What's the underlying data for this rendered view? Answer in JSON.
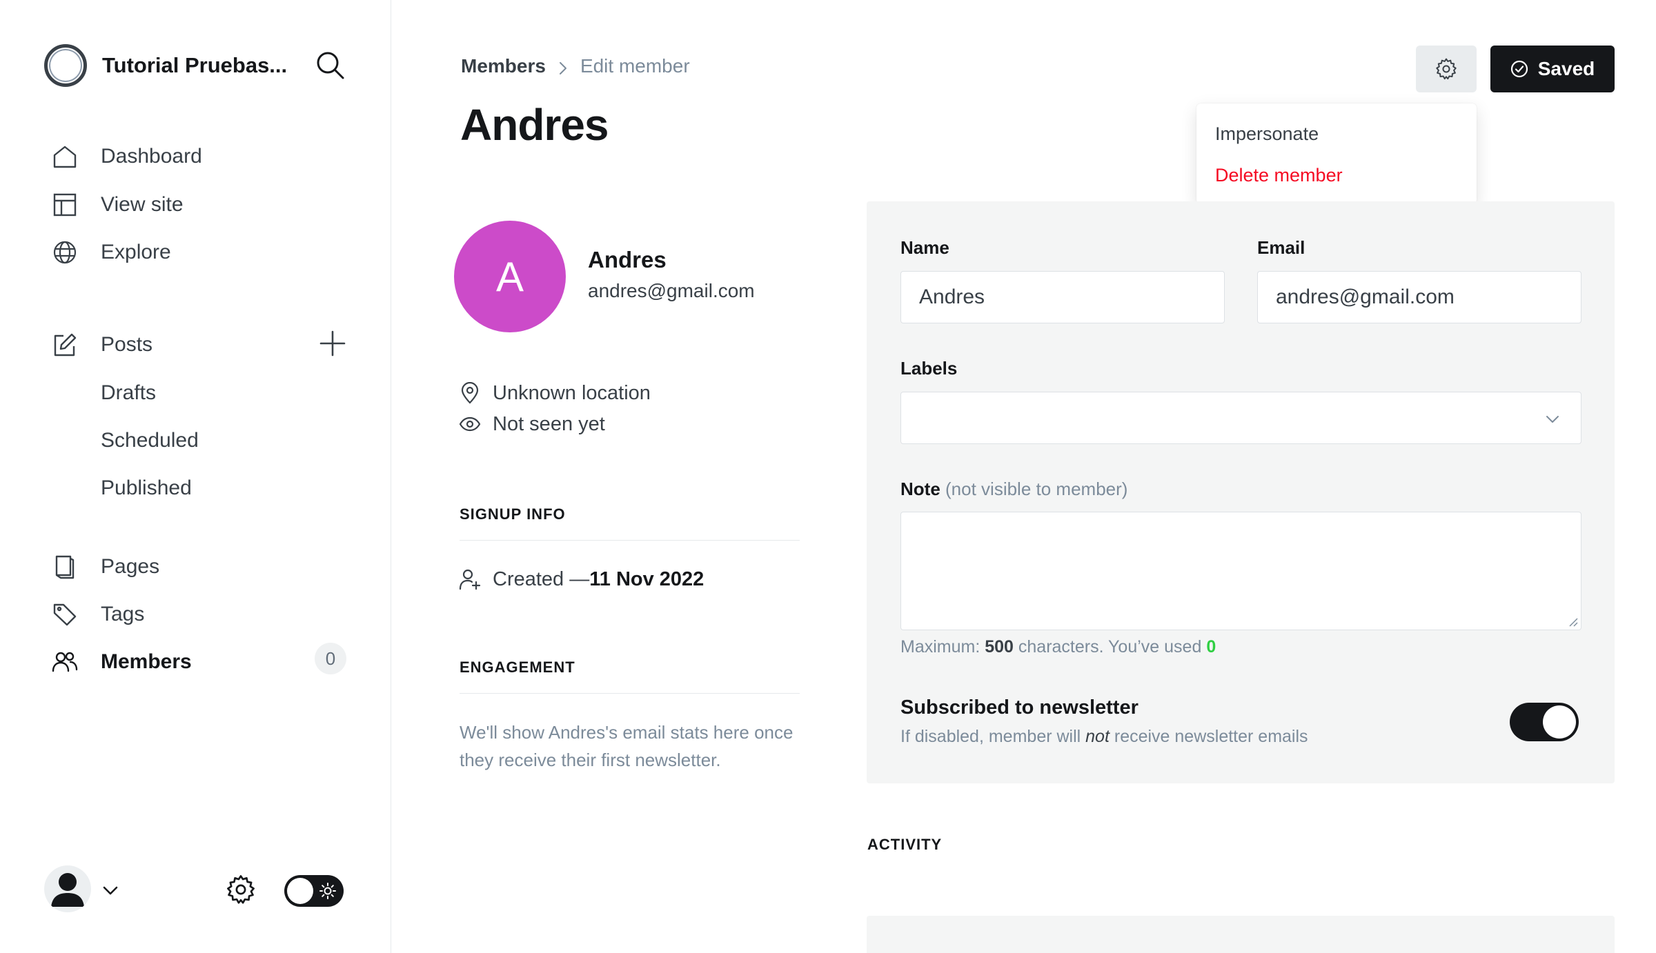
{
  "sidebar": {
    "site_title": "Tutorial Pruebas...",
    "nav": {
      "dashboard": "Dashboard",
      "view_site": "View site",
      "explore": "Explore",
      "posts": "Posts",
      "drafts": "Drafts",
      "scheduled": "Scheduled",
      "published": "Published",
      "pages": "Pages",
      "tags": "Tags",
      "members": "Members",
      "members_count": "0"
    },
    "active_item": "Members"
  },
  "header": {
    "breadcrumb_parent": "Members",
    "breadcrumb_current": "Edit member",
    "title": "Andres",
    "saved_label": "Saved"
  },
  "dropdown": {
    "impersonate": "Impersonate",
    "delete_member": "Delete member"
  },
  "member": {
    "initial": "A",
    "name": "Andres",
    "email": "andres@gmail.com",
    "location": "Unknown location",
    "last_seen": "Not seen yet",
    "avatar_color": "#cc4bc9"
  },
  "signup": {
    "section_title": "SIGNUP INFO",
    "created_prefix": "Created — ",
    "created_date": "11 Nov 2022"
  },
  "engagement": {
    "section_title": "ENGAGEMENT",
    "text": "We'll show Andres's email stats here once they receive their first newsletter."
  },
  "form": {
    "name_label": "Name",
    "name_value": "Andres",
    "email_label": "Email",
    "email_value": "andres@gmail.com",
    "labels_label": "Labels",
    "labels_value": "",
    "note_label": "Note",
    "note_hint": "(not visible to member)",
    "note_value": "",
    "char_prefix": "Maximum: ",
    "char_max": "500",
    "char_middle": " characters. You’ve used ",
    "char_used": "0",
    "newsletter_title": "Subscribed to newsletter",
    "newsletter_desc_prefix": "If disabled, member will ",
    "newsletter_desc_em": "not",
    "newsletter_desc_suffix": " receive newsletter emails",
    "newsletter_subscribed": true
  },
  "activity": {
    "section_title": "ACTIVITY"
  },
  "colors": {
    "accent_dark": "#15171a",
    "danger": "#f50b23",
    "success": "#30cf43",
    "muted_text": "#7c8b9a"
  }
}
